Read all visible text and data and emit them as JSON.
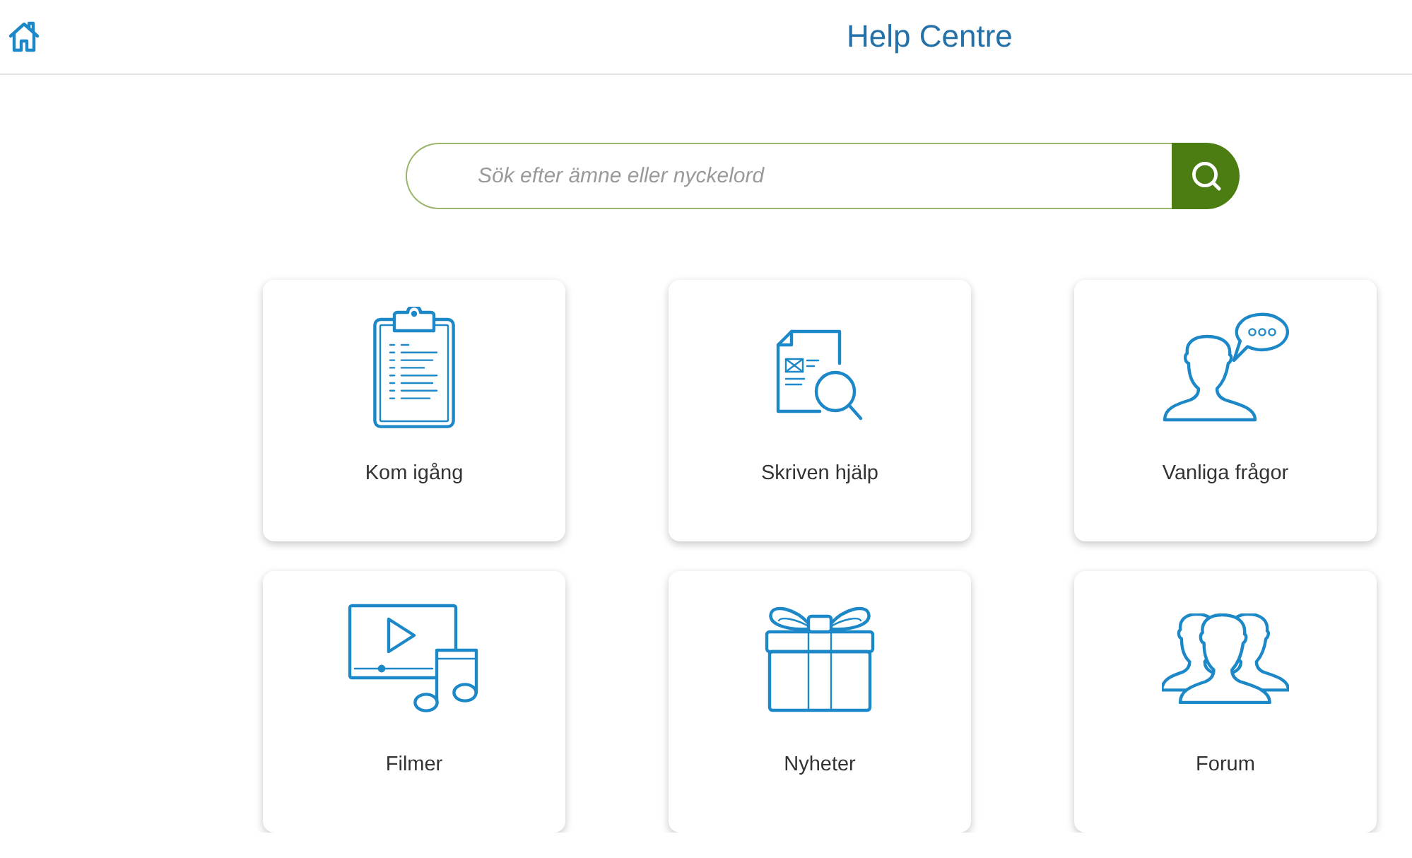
{
  "header": {
    "title": "Help Centre"
  },
  "search": {
    "placeholder": "Sök efter ämne eller nyckelord"
  },
  "topics": [
    {
      "label": "Kom igång",
      "kind": "clipboard"
    },
    {
      "label": "Skriven hjälp",
      "kind": "document"
    },
    {
      "label": "Vanliga frågor",
      "kind": "question"
    },
    {
      "label": "Filmer",
      "kind": "media"
    },
    {
      "label": "Nyheter",
      "kind": "gift"
    },
    {
      "label": "Forum",
      "kind": "group"
    }
  ]
}
